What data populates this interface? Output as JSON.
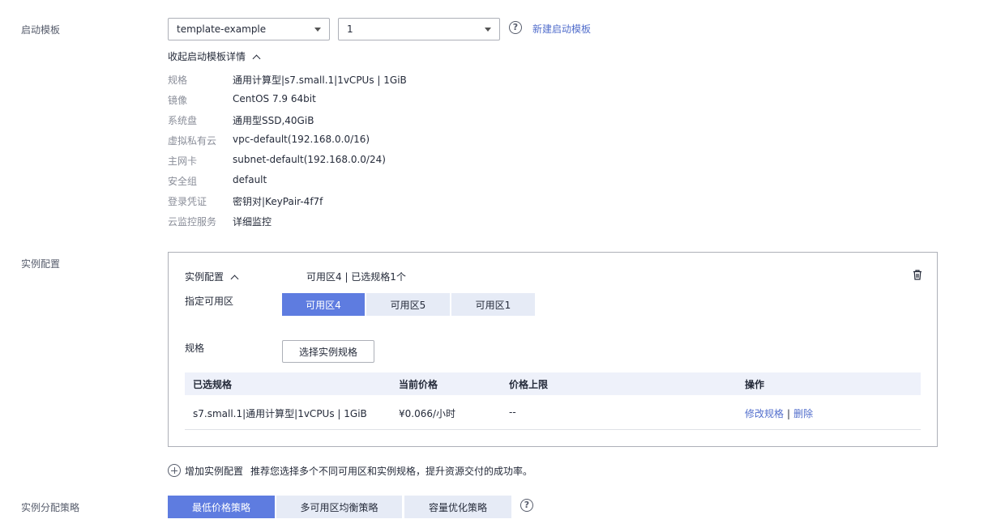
{
  "launch_template": {
    "label": "启动模板",
    "template_select": "template-example",
    "version_select": "1",
    "new_template_link": "新建启动模板",
    "collapse_details": "收起启动模板详情",
    "details": [
      {
        "key": "规格",
        "value": "通用计算型|s7.small.1|1vCPUs | 1GiB"
      },
      {
        "key": "镜像",
        "value": "CentOS 7.9 64bit"
      },
      {
        "key": "系统盘",
        "value": "通用型SSD,40GiB"
      },
      {
        "key": "虚拟私有云",
        "value": "vpc-default(192.168.0.0/16)"
      },
      {
        "key": "主网卡",
        "value": "subnet-default(192.168.0.0/24)"
      },
      {
        "key": "安全组",
        "value": "default"
      },
      {
        "key": "登录凭证",
        "value": "密钥对|KeyPair-4f7f"
      },
      {
        "key": "云监控服务",
        "value": "详细监控"
      }
    ]
  },
  "instance_config": {
    "label": "实例配置",
    "panel_title": "实例配置",
    "summary": "可用区4 | 已选规格1个",
    "az_label": "指定可用区",
    "az_options": [
      "可用区4",
      "可用区5",
      "可用区1"
    ],
    "az_selected": "可用区4",
    "flavor_label": "规格",
    "select_flavor_button": "选择实例规格",
    "table_headers": [
      "已选规格",
      "当前价格",
      "价格上限",
      "操作"
    ],
    "table_rows": [
      {
        "flavor": "s7.small.1|通用计算型|1vCPUs | 1GiB",
        "price": "¥0.066/小时",
        "limit": "--",
        "action_modify": "修改规格",
        "action_delete": "删除"
      }
    ],
    "add_config": "增加实例配置",
    "add_config_hint": "推荐您选择多个不同可用区和实例规格，提升资源交付的成功率。"
  },
  "allocation_strategy": {
    "label": "实例分配策略",
    "options": [
      "最低价格策略",
      "多可用区均衡策略",
      "容量优化策略"
    ],
    "selected": "最低价格策略"
  },
  "colors": {
    "primary": "#5e7ce0",
    "link": "#526ecc",
    "segment_bg": "#e6ebf6"
  },
  "icons": [
    "caret-down-icon",
    "help-icon",
    "chevron-up-icon",
    "trash-icon",
    "plus-circle-icon"
  ]
}
